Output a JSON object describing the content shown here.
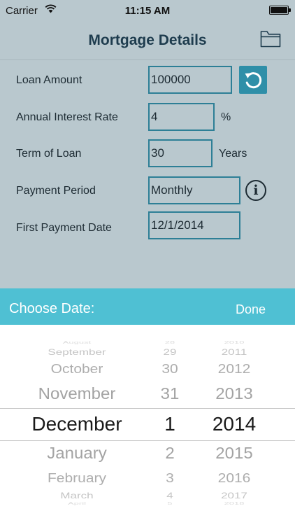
{
  "status_bar": {
    "carrier": "Carrier",
    "time": "11:15 AM"
  },
  "nav": {
    "title": "Mortgage Details"
  },
  "form": {
    "loan_amount": {
      "label": "Loan Amount",
      "value": "100000"
    },
    "interest_rate": {
      "label": "Annual Interest Rate",
      "value": "4",
      "unit": "%"
    },
    "term": {
      "label": "Term of Loan",
      "value": "30",
      "unit": "Years"
    },
    "payment_period": {
      "label": "Payment Period",
      "value": "Monthly"
    },
    "first_payment": {
      "label": "First Payment Date",
      "value": "12/1/2014"
    }
  },
  "picker": {
    "title": "Choose Date:",
    "done_label": "Done",
    "months": [
      "August",
      "September",
      "October",
      "November",
      "December",
      "January",
      "February",
      "March",
      "April"
    ],
    "days": [
      "28",
      "29",
      "30",
      "31",
      "1",
      "2",
      "3",
      "4",
      "5"
    ],
    "years": [
      "2010",
      "2011",
      "2012",
      "2013",
      "2014",
      "2015",
      "2016",
      "2017",
      "2018"
    ],
    "selected": {
      "month": "December",
      "day": "1",
      "year": "2014"
    }
  },
  "colors": {
    "accent": "#4fc0d3",
    "field_border": "#2d7f96",
    "dim_background": "#b9c8ce"
  }
}
